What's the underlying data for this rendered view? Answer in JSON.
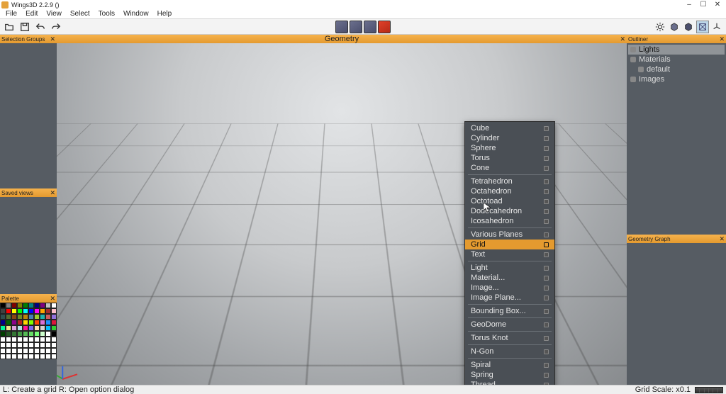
{
  "title": "Wings3D 2.2.9 ()",
  "window_controls": {
    "min": "–",
    "max": "☐",
    "close": "✕"
  },
  "menu": [
    "File",
    "Edit",
    "View",
    "Select",
    "Tools",
    "Window",
    "Help"
  ],
  "selection_modes": [
    {
      "name": "vertex",
      "active": false
    },
    {
      "name": "edge",
      "active": false
    },
    {
      "name": "face",
      "active": false
    },
    {
      "name": "body",
      "active": true
    }
  ],
  "panels": {
    "selection_groups": "Selection Groups",
    "saved_views": "Saved views",
    "palette": "Palette",
    "geometry": "Geometry",
    "outliner": "Outliner",
    "geometry_graph": "Geometry Graph"
  },
  "outliner": {
    "items": [
      {
        "label": "Lights",
        "selected": true
      },
      {
        "label": "Materials",
        "selected": false
      },
      {
        "label": "default",
        "selected": false,
        "indent": true
      },
      {
        "label": "Images",
        "selected": false
      }
    ]
  },
  "palette_colors": [
    "#000000",
    "#808080",
    "#800000",
    "#808000",
    "#008000",
    "#008080",
    "#000080",
    "#800080",
    "#c0c0c0",
    "#ffffff",
    "#404040",
    "#ff0000",
    "#ffff00",
    "#00ff00",
    "#00ffff",
    "#0000ff",
    "#ff00ff",
    "#ffa500",
    "#a52a2a",
    "#ffc0cb",
    "#2f4f4f",
    "#556b2f",
    "#8b4513",
    "#6b8e23",
    "#b8860b",
    "#4682b4",
    "#9acd32",
    "#20b2aa",
    "#cd5c5c",
    "#9370db",
    "#00008b",
    "#006400",
    "#8b008b",
    "#b22222",
    "#ffd700",
    "#7fff00",
    "#ff4500",
    "#da70d6",
    "#1e90ff",
    "#dc143c",
    "#00fa9a",
    "#f0e68c",
    "#dda0dd",
    "#b0e0e6",
    "#ff1493",
    "#7b68ee",
    "#ffdead",
    "#d3d3d3",
    "#00bfff",
    "#32cd32",
    "#004000",
    "#225522",
    "#337733",
    "#449944",
    "#55bb55",
    "#66dd66",
    "#77ff77",
    "#ccffcc",
    "#ffffff",
    "#000000",
    "#ffffff",
    "#ffffff",
    "#ffffff",
    "#ffffff",
    "#ffffff",
    "#ffffff",
    "#ffffff",
    "#ffffff",
    "#ffffff",
    "#ffffff",
    "#ffffff",
    "#ffffff",
    "#ffffff",
    "#ffffff",
    "#ffffff",
    "#ffffff",
    "#ffffff",
    "#ffffff",
    "#ffffff",
    "#ffffff",
    "#ffffff",
    "#ffffff",
    "#ffffff",
    "#ffffff",
    "#ffffff",
    "#ffffff",
    "#ffffff",
    "#ffffff",
    "#ffffff",
    "#ffffff",
    "#ffffff",
    "#ffffff",
    "#ffffff",
    "#ffffff",
    "#ffffff",
    "#ffffff",
    "#ffffff",
    "#ffffff",
    "#ffffff",
    "#ffffff"
  ],
  "context_menu": {
    "groups": [
      [
        "Cube",
        "Cylinder",
        "Sphere",
        "Torus",
        "Cone"
      ],
      [
        "Tetrahedron",
        "Octahedron",
        "Octotoad",
        "Dodecahedron",
        "Icosahedron"
      ],
      [
        "Various Planes",
        "Grid",
        "Text"
      ],
      [
        "Light",
        "Material...",
        "Image...",
        "Image Plane..."
      ],
      [
        "Bounding Box..."
      ],
      [
        "GeoDome"
      ],
      [
        "Torus Knot"
      ],
      [
        "N-Gon"
      ],
      [
        "Spiral",
        "Spring",
        "Thread"
      ]
    ],
    "highlighted": "Grid"
  },
  "status": {
    "left": "L: Create a grid   R: Open option dialog",
    "right": "Grid Scale: x0.1"
  }
}
